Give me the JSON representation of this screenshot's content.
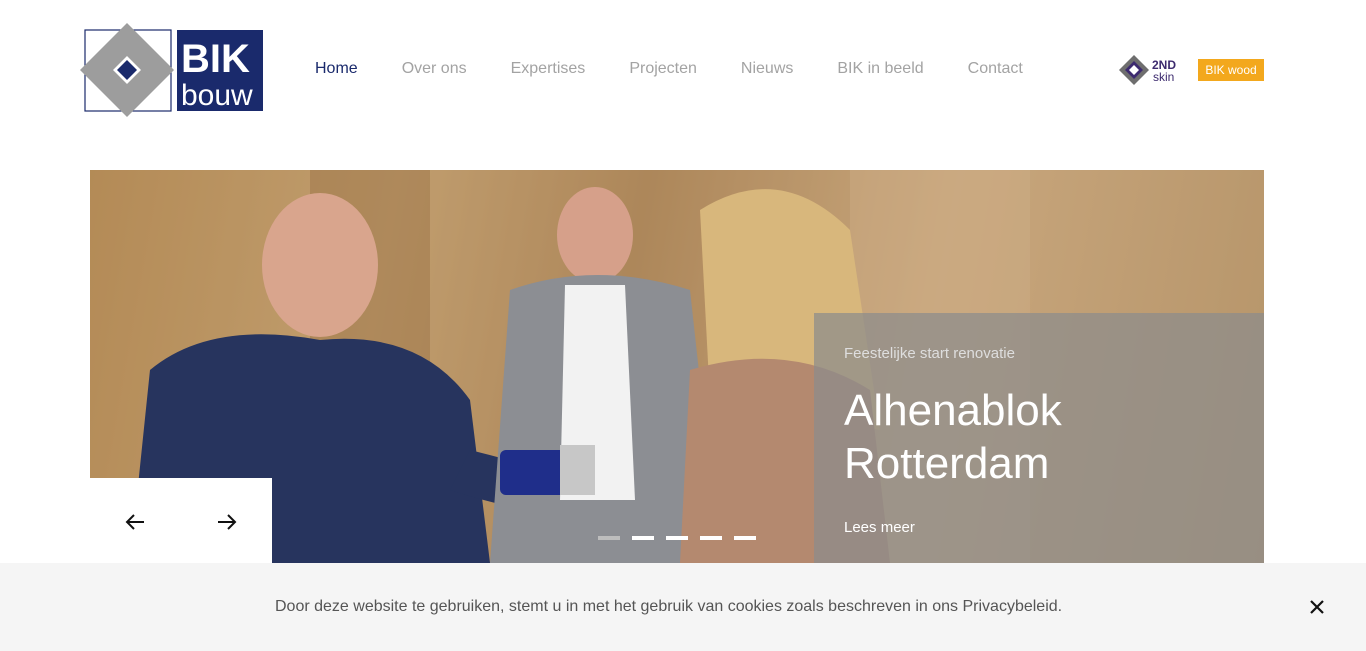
{
  "brand": {
    "logo_word1": "BIK",
    "logo_word2": "bouw",
    "primary_color": "#1a2a6c",
    "accent_color": "#f3a81d"
  },
  "nav": {
    "items": [
      {
        "label": "Home",
        "active": true
      },
      {
        "label": "Over ons",
        "active": false
      },
      {
        "label": "Expertises",
        "active": false
      },
      {
        "label": "Projecten",
        "active": false
      },
      {
        "label": "Nieuws",
        "active": false
      },
      {
        "label": "BIK in beeld",
        "active": false
      },
      {
        "label": "Contact",
        "active": false
      }
    ]
  },
  "partners": {
    "second_skin_top": "2ND",
    "second_skin_bottom": "skin",
    "bik_wood": "BIK wood"
  },
  "slider": {
    "kicker": "Feestelijke start renovatie",
    "title": "Alhenablok Rotterdam",
    "link": "Lees meer",
    "slide_count": 5,
    "current_slide": 1
  },
  "cookie": {
    "message": "Door deze website te gebruiken, stemt u in met het gebruik van cookies zoals beschreven in ons Privacybeleid."
  }
}
